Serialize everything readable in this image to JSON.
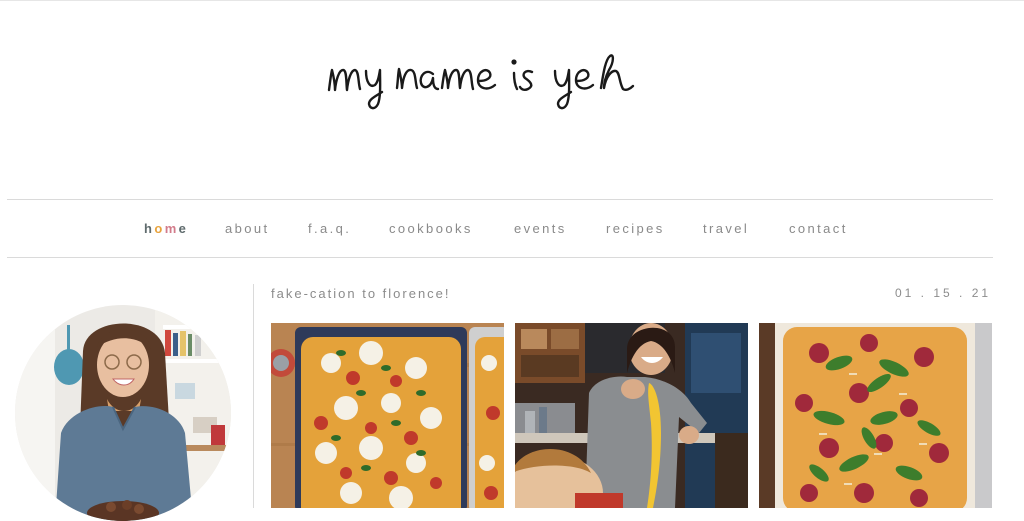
{
  "site": {
    "logo_text": "my name is yeh"
  },
  "nav": {
    "items": [
      {
        "label": "home",
        "id": "home"
      },
      {
        "label": "about",
        "id": "about"
      },
      {
        "label": "f.a.q.",
        "id": "faq"
      },
      {
        "label": "cookbooks",
        "id": "cookbooks"
      },
      {
        "label": "events",
        "id": "events"
      },
      {
        "label": "recipes",
        "id": "recipes"
      },
      {
        "label": "travel",
        "id": "travel"
      },
      {
        "label": "contact",
        "id": "contact"
      }
    ],
    "home_colors": [
      "#5f6b6d",
      "#e8a33d",
      "#d27b8a",
      "#5f6b6d"
    ]
  },
  "post": {
    "title": "fake-cation to florence!",
    "date": "01 . 15 . 21"
  },
  "colors": {
    "text": "#8a8a8a",
    "rule": "#dadada"
  }
}
